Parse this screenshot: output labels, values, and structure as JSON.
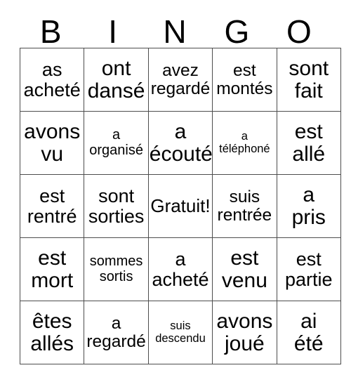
{
  "card": {
    "title_letters": [
      "B",
      "I",
      "N",
      "G",
      "O"
    ],
    "free_space_label": "Gratuit!",
    "grid_line_color": "#4d4d4d",
    "text_color": "#000000",
    "background_color": "#ffffff",
    "columns": 5,
    "rows": 5,
    "cells": [
      [
        {
          "line1": "as",
          "line2": "acheté",
          "size": "lg"
        },
        {
          "line1": "ont",
          "line2": "dansé",
          "size": "xl"
        },
        {
          "line1": "avez",
          "line2": "regardé",
          "size": "md"
        },
        {
          "line1": "est",
          "line2": "montés",
          "size": "md"
        },
        {
          "line1": "sont",
          "line2": "fait",
          "size": "xl"
        }
      ],
      [
        {
          "line1": "avons",
          "line2": "vu",
          "size": "xl"
        },
        {
          "line1": "a",
          "line2": "organisé",
          "size": "sm"
        },
        {
          "line1": "a",
          "line2": "écouté",
          "size": "xl"
        },
        {
          "line1": "a",
          "line2": "téléphoné",
          "size": "xs"
        },
        {
          "line1": "est",
          "line2": "allé",
          "size": "xl"
        }
      ],
      [
        {
          "line1": "est",
          "line2": "rentré",
          "size": "lg"
        },
        {
          "line1": "sont",
          "line2": "sorties",
          "size": "lg"
        },
        {
          "line1": "Gratuit!",
          "line2": "",
          "size": "free"
        },
        {
          "line1": "suis",
          "line2": "rentrée",
          "size": "md"
        },
        {
          "line1": "a",
          "line2": "pris",
          "size": "xl"
        }
      ],
      [
        {
          "line1": "est",
          "line2": "mort",
          "size": "xl"
        },
        {
          "line1": "sommes",
          "line2": "sortis",
          "size": "sm"
        },
        {
          "line1": "a",
          "line2": "acheté",
          "size": "lg"
        },
        {
          "line1": "est",
          "line2": "venu",
          "size": "xl"
        },
        {
          "line1": "est",
          "line2": "partie",
          "size": "lg"
        }
      ],
      [
        {
          "line1": "êtes",
          "line2": "allés",
          "size": "xl"
        },
        {
          "line1": "a",
          "line2": "regardé",
          "size": "md"
        },
        {
          "line1": "suis",
          "line2": "descendu",
          "size": "xs"
        },
        {
          "line1": "avons",
          "line2": "joué",
          "size": "xl"
        },
        {
          "line1": "ai",
          "line2": "été",
          "size": "xl"
        }
      ]
    ]
  }
}
